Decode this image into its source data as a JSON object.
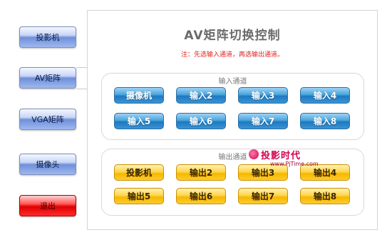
{
  "nav": {
    "items": [
      {
        "label": "投影机"
      },
      {
        "label": "AV矩阵"
      },
      {
        "label": "VGA矩阵"
      },
      {
        "label": "摄像头"
      },
      {
        "label": "退出"
      }
    ]
  },
  "main": {
    "title": "AV矩阵切换控制",
    "notice": "注：先选输入通道，再选输出通道。",
    "input_group": {
      "label": "输入通道",
      "buttons": [
        "摄像机",
        "输入2",
        "输入3",
        "输入4",
        "输入5",
        "输入6",
        "输入7",
        "输入8"
      ]
    },
    "output_group": {
      "label": "输出通道",
      "buttons": [
        "投影机",
        "输出2",
        "输出3",
        "输出4",
        "输出5",
        "输出6",
        "输出7",
        "输出8"
      ]
    }
  },
  "watermark": {
    "text": "投影时代",
    "url": "www.PjTime.com"
  },
  "colors": {
    "nav_blue": "#6f8fd9",
    "exit_red": "#e00000",
    "input_blue": "#1f79bf",
    "output_yellow": "#f5b800",
    "notice_red": "#e02020"
  }
}
